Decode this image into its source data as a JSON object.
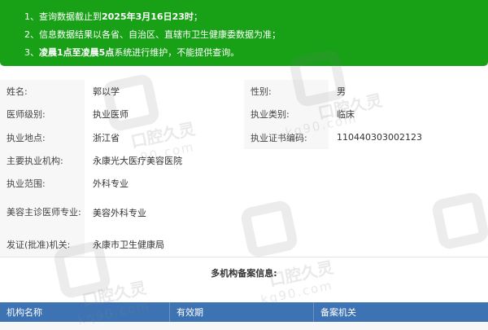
{
  "notice": {
    "line1_prefix": "1、查询数据截止到",
    "line1_bold": "2025年3月16日23时",
    "line1_suffix": "；",
    "line2": "2、信息数据结果以各省、自治区、直辖市卫生健康委数据为准；",
    "line3_prefix": "3、",
    "line3_bold1": "凌晨1点至凌晨5点",
    "line3_suffix": "系统进行维护，不能提供查询。"
  },
  "info": {
    "name_label": "姓名:",
    "name_value": "郭以学",
    "gender_label": "性别:",
    "gender_value": "男",
    "level_label": "医师级别:",
    "level_value": "执业医师",
    "category_label": "执业类别:",
    "category_value": "临床",
    "location_label": "执业地点:",
    "location_value": "浙江省",
    "cert_label": "执业证书编码:",
    "cert_value": "110440303002123",
    "org_label": "主要执业机构:",
    "org_value": "永康光大医疗美容医院",
    "scope_label": "执业范围:",
    "scope_value": "外科专业",
    "cosmetic_label": "美容主诊医师专业:",
    "cosmetic_value": "美容外科专业",
    "issuer_label": "发证(批准)机关:",
    "issuer_value": "永康市卫生健康局"
  },
  "multi": {
    "title": "多机构备案信息:",
    "columns": [
      "机构名称",
      "有效期",
      "备案机关"
    ]
  },
  "watermark": {
    "text_cn": "口腔久灵",
    "text_en": "kq90.com"
  }
}
